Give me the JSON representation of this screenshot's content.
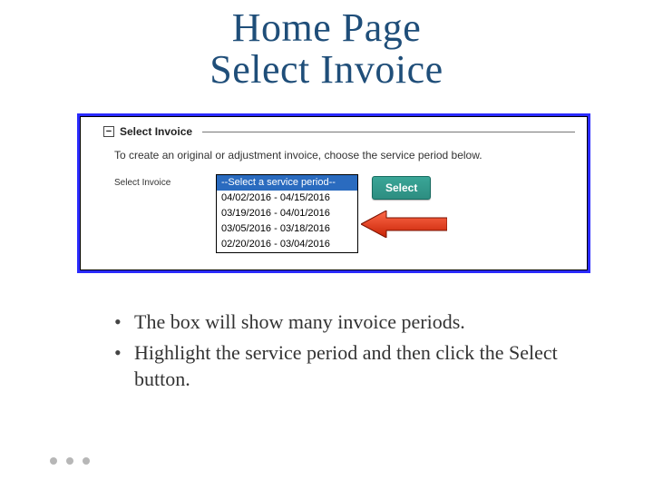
{
  "title_line1": "Home Page",
  "title_line2": "Select Invoice",
  "screenshot": {
    "section_title": "Select Invoice",
    "instruction": "To create an original or adjustment invoice, choose the service period below.",
    "field_label": "Select Invoice",
    "options": {
      "placeholder": "--Select a service period--",
      "o1": "04/02/2016 - 04/15/2016",
      "o2": "03/19/2016 - 04/01/2016",
      "o3": "03/05/2016 - 03/18/2016",
      "o4": "02/20/2016 - 03/04/2016"
    },
    "select_button": "Select"
  },
  "bullets": {
    "b1": "The box will show many invoice periods.",
    "b2": "Highlight the service period and then click the Select button."
  }
}
